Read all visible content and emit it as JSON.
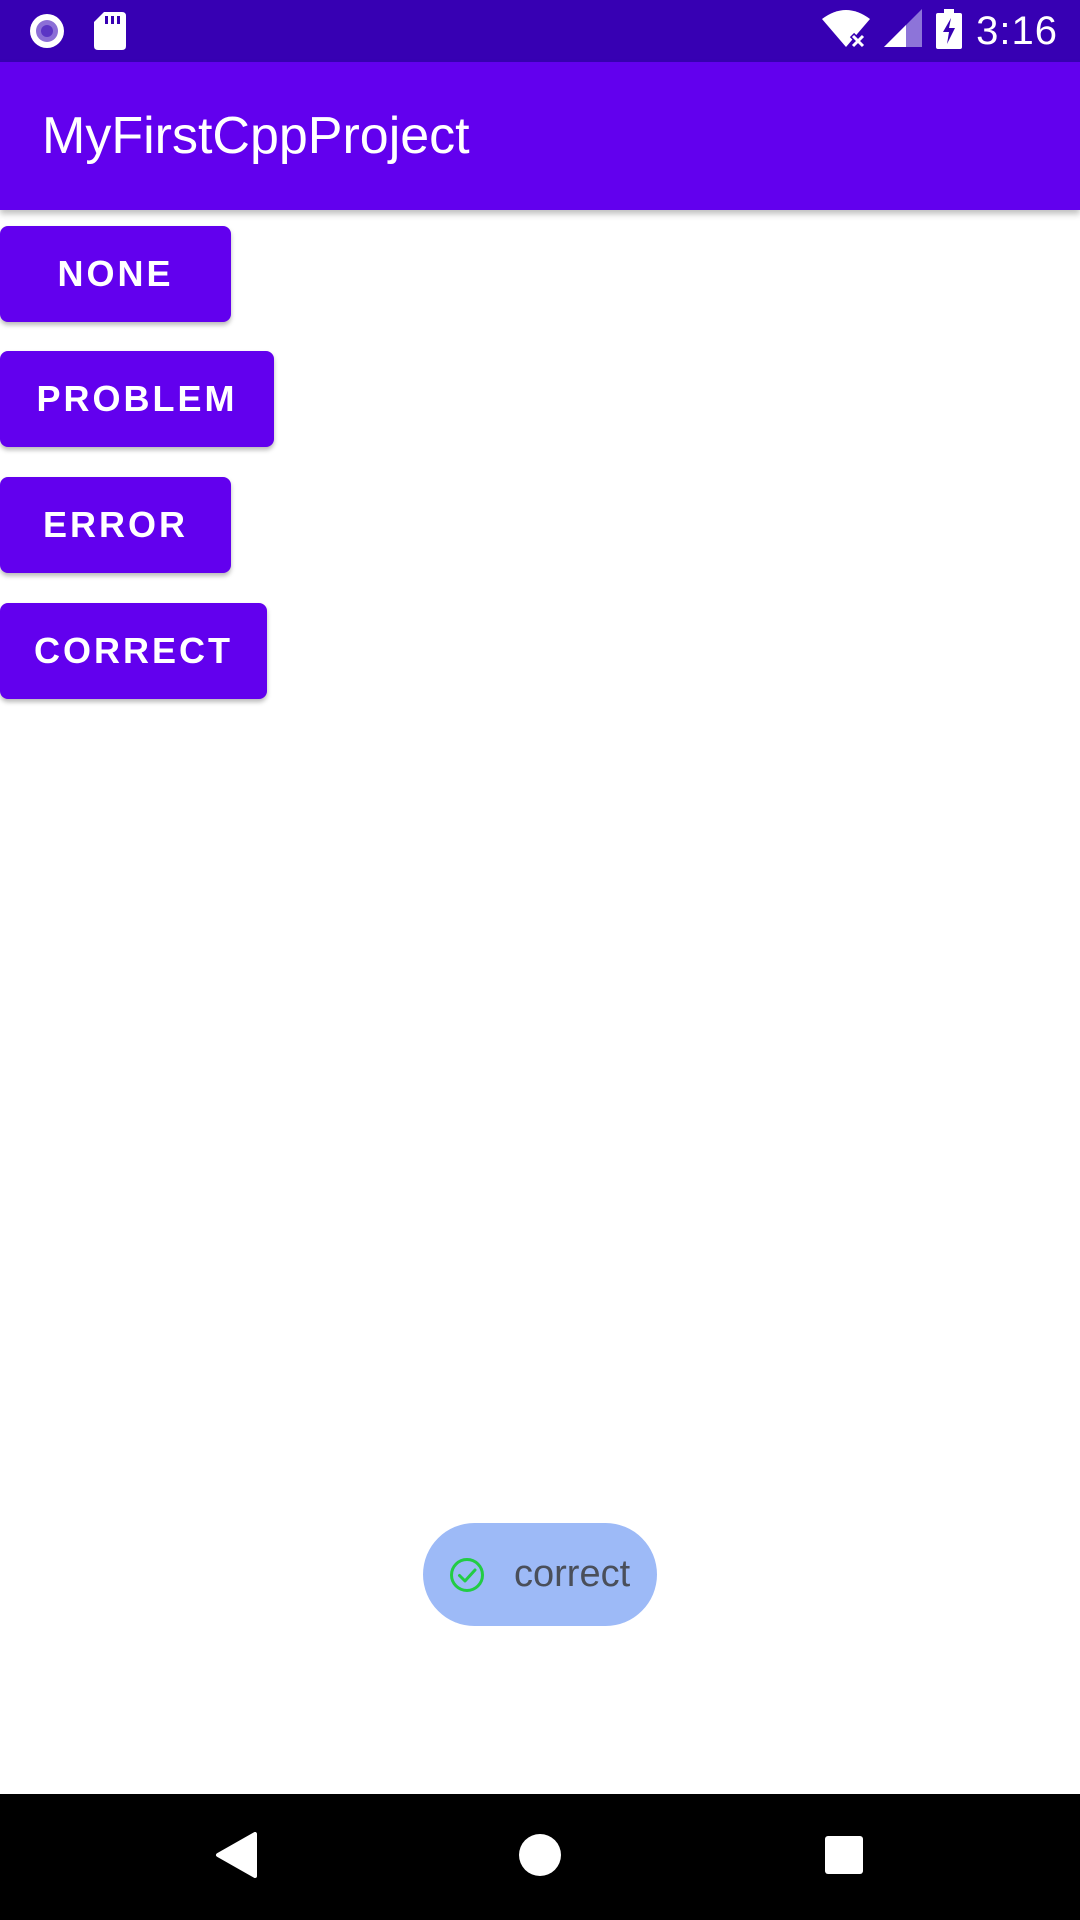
{
  "status_bar": {
    "time": "3:16",
    "icons": [
      "record-icon",
      "sd-card-icon",
      "wifi-off-icon",
      "signal-icon",
      "battery-charging-icon"
    ]
  },
  "app_bar": {
    "title": "MyFirstCppProject"
  },
  "buttons": {
    "none": "NONE",
    "problem": "PROBLEM",
    "error": "ERROR",
    "correct": "CORRECT"
  },
  "toast": {
    "text": "correct",
    "icon": "check-circle-icon"
  },
  "nav_bar": {
    "icons": [
      "back-icon",
      "home-icon",
      "recents-icon"
    ]
  },
  "colors": {
    "status_bar": "#3700b3",
    "primary": "#6200ee",
    "toast_bg": "#9dbaf7",
    "toast_check": "#22cc44"
  }
}
